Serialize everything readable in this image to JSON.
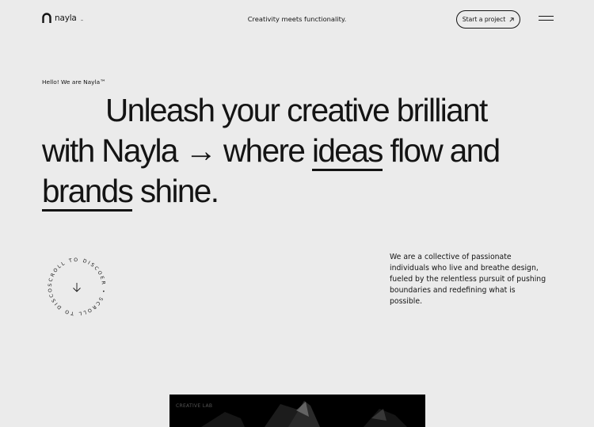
{
  "header": {
    "brand": "nayla",
    "brand_tm": "™",
    "tagline": "Creativity meets functionality.",
    "cta_label": "Start a project",
    "cta_icon": "arrow-up-right-icon",
    "menu_icon": "hamburger-menu-icon"
  },
  "hero": {
    "intro": "Hello! We are Nayla™",
    "line1": "Unleash your creative brilliant",
    "line2_a": "with Nayla → where ",
    "line2_b": "ideas",
    "line2_c": " flow and",
    "line3_a": "brands",
    "line3_b": " shine."
  },
  "scroll": {
    "ring_text": "SCROLL TO DISCOER • SCROLL TO DISCOER •",
    "icon": "arrow-down-icon"
  },
  "about": {
    "text": "We are a collective of passionate individuals who live and breathe design, fueled by the relentless pursuit of pushing boundaries and redefining what is possible."
  },
  "media": {
    "label": "CREATIVE LAB"
  },
  "colors": {
    "background": "#ebebeb",
    "text": "#141414",
    "media": "#000000"
  }
}
